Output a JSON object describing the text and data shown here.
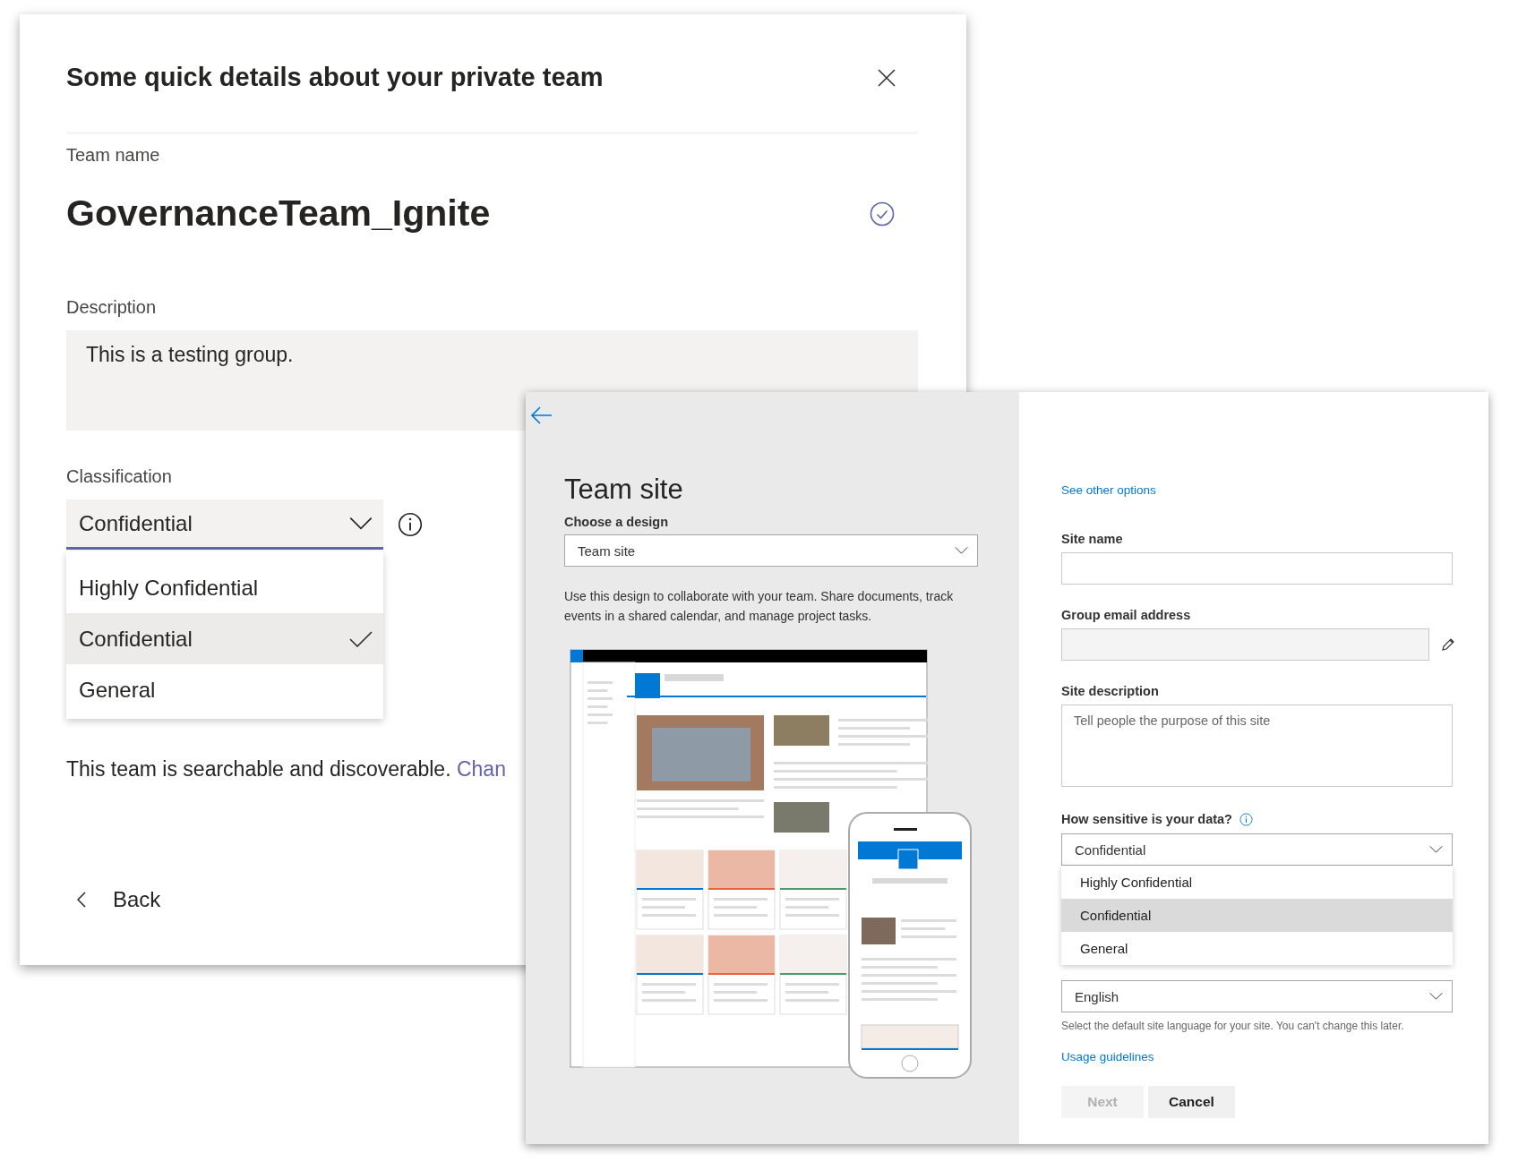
{
  "dialog": {
    "title": "Some quick details about your private team",
    "team_name_label": "Team name",
    "team_name": "GovernanceTeam_Ignite",
    "team_name_valid": true,
    "description_label": "Description",
    "description": "This is a testing group.",
    "classification": {
      "label": "Classification",
      "value": "Confidential",
      "options": [
        {
          "label": "Highly Confidential",
          "selected": false
        },
        {
          "label": "Confidential",
          "selected": true
        },
        {
          "label": "General",
          "selected": false
        }
      ]
    },
    "discoverability_text": "This team is searchable and discoverable.",
    "change_link": "Chan",
    "back": "Back"
  },
  "site_panel": {
    "heading": "Team site",
    "design_label": "Choose a design",
    "design_value": "Team site",
    "design_description": "Use this design to collaborate with your team. Share documents, track events in a shared calendar, and manage project tasks.",
    "other_options_link": "See other options",
    "fields": [
      {
        "kind": "text",
        "label": "Site name"
      },
      {
        "kind": "email",
        "label": "Group email address"
      },
      {
        "kind": "textarea",
        "label": "Site description",
        "placeholder": "Tell people the purpose of this site"
      }
    ],
    "sensitivity": {
      "label": "How sensitive is your data?",
      "value": "Confidential",
      "options": [
        {
          "label": "Highly Confidential",
          "selected": false
        },
        {
          "label": "Confidential",
          "selected": true
        },
        {
          "label": "General",
          "selected": false
        }
      ]
    },
    "language": {
      "value": "English",
      "help": "Select the default site language for your site. You can't change this later."
    },
    "usage_link": "Usage guidelines",
    "buttons": [
      {
        "label": "Next",
        "disabled": true
      },
      {
        "label": "Cancel",
        "disabled": false
      }
    ]
  }
}
